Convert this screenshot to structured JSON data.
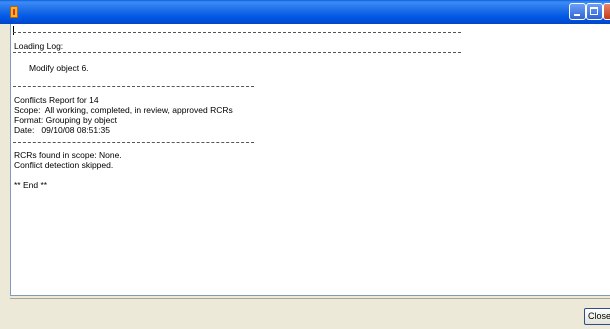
{
  "window": {
    "title": "",
    "controls": [
      "minimize-icon",
      "maximize-icon",
      "close-icon"
    ],
    "accent": "#0058e6"
  },
  "log": {
    "lines": [
      "Loading Log:",
      "Modify object 6.",
      "Conflicts Report for 14",
      "Scope:  All working, completed, in review, approved RCRs",
      "Format: Grouping by object",
      "Date:   09/10/08 08:51:35",
      "RCRs found in scope: None.",
      "Conflict detection skipped.",
      "** End **"
    ]
  },
  "footer": {
    "close_label": "Close"
  }
}
